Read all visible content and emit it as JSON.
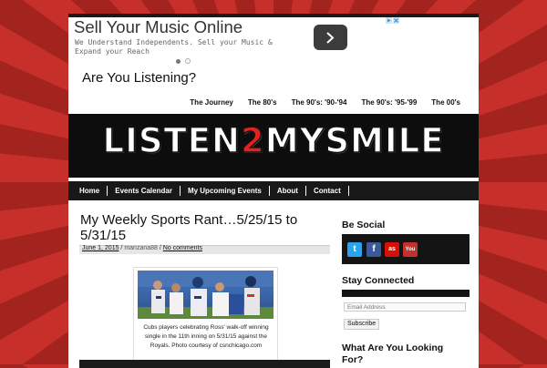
{
  "ad": {
    "title": "Sell Your Music Online",
    "description": "We Understand Independents. Sell your Music & Expand your Reach"
  },
  "site": {
    "title": "Are You Listening?",
    "banner_left": "LISTEN",
    "banner_mid": "2",
    "banner_right": "MYSMILE"
  },
  "top_nav": [
    "The Journey",
    "The 80's",
    "The 90's: '90-'94",
    "The 90's: '95-'99",
    "The 00's"
  ],
  "main_nav": [
    "Home",
    "Events Calendar",
    "My Upcoming Events",
    "About",
    "Contact"
  ],
  "post": {
    "title": "My Weekly Sports Rant…5/25/15 to 5/31/15",
    "date": "June 1, 2015",
    "author": "manzana88",
    "comments": "No comments",
    "caption": "Cubs players celebrating Ross' walk-off winning single in the 11th inning on 5/31/15 against the Royals. Photo courtesy of csnchicago.com"
  },
  "sidebar": {
    "be_social": "Be Social",
    "stay_connected": "Stay Connected",
    "email_placeholder": "Email Address",
    "subscribe": "Subscribe",
    "looking_for": "What Are You Looking For?"
  },
  "social_icons": [
    {
      "name": "twitter-icon",
      "color": "#2aa3ef"
    },
    {
      "name": "facebook-icon",
      "color": "#3b5998"
    },
    {
      "name": "lastfm-icon",
      "color": "#d51007"
    },
    {
      "name": "youtube-icon",
      "color": "#c4302b"
    }
  ],
  "colors": {
    "accent": "#e02320",
    "banner_bg": "#0d0d0d",
    "nav_bg": "#181818"
  }
}
